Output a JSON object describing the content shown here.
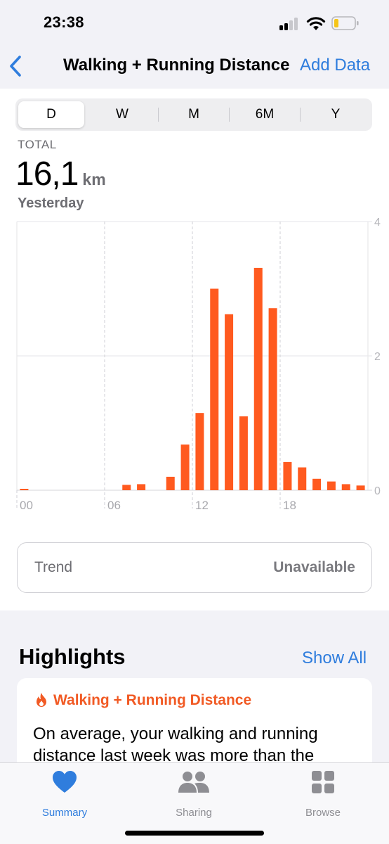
{
  "status_bar": {
    "time": "23:38"
  },
  "nav": {
    "back_icon": "chevron-left-icon",
    "title": "Walking + Running Distance",
    "action_label": "Add Data"
  },
  "segments": [
    {
      "label": "D",
      "active": true
    },
    {
      "label": "W",
      "active": false
    },
    {
      "label": "M",
      "active": false
    },
    {
      "label": "6M",
      "active": false
    },
    {
      "label": "Y",
      "active": false
    }
  ],
  "summary": {
    "label": "TOTAL",
    "value": "16,1",
    "unit": "km",
    "period": "Yesterday"
  },
  "chart_data": {
    "type": "bar",
    "x": [
      0,
      1,
      2,
      3,
      4,
      5,
      6,
      7,
      8,
      9,
      10,
      11,
      12,
      13,
      14,
      15,
      16,
      17,
      18,
      19,
      20,
      21,
      22,
      23
    ],
    "values": [
      0.01,
      0,
      0,
      0,
      0,
      0,
      0,
      0.08,
      0.09,
      0,
      0.2,
      0.68,
      1.15,
      3.0,
      2.62,
      1.1,
      3.31,
      2.71,
      0.42,
      0.34,
      0.17,
      0.13,
      0.09,
      0.07
    ],
    "x_tick_labels": [
      "00",
      "06",
      "12",
      "18"
    ],
    "x_tick_positions": [
      0,
      6,
      12,
      18
    ],
    "y_tick_labels": [
      "0",
      "2",
      "4"
    ],
    "ylim": [
      0,
      4
    ],
    "bar_color": "#ff5a1f",
    "grid": true,
    "y_axis_position": "right"
  },
  "trend": {
    "label": "Trend",
    "value": "Unavailable"
  },
  "highlights": {
    "title": "Highlights",
    "show_all": "Show All",
    "card": {
      "icon": "flame-icon",
      "title": "Walking + Running Distance",
      "text": "On average, your walking and running distance last week was more than the"
    }
  },
  "tabs": [
    {
      "label": "Summary",
      "icon": "heart-icon",
      "active": true
    },
    {
      "label": "Sharing",
      "icon": "people-icon",
      "active": false
    },
    {
      "label": "Browse",
      "icon": "grid-icon",
      "active": false
    }
  ],
  "colors": {
    "accent": "#2f7ddd",
    "activity": "#f15a24",
    "background": "#f2f2f7"
  }
}
